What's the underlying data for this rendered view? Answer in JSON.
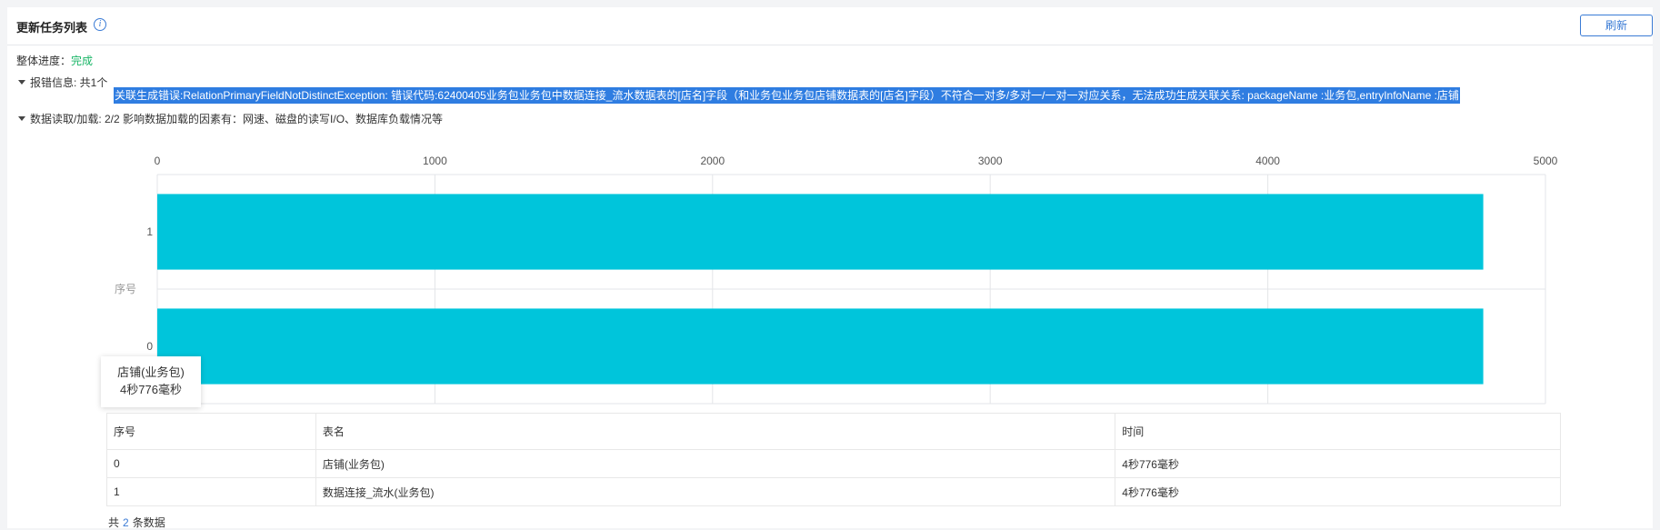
{
  "header": {
    "title": "更新任务列表",
    "refresh_label": "刷新"
  },
  "progress": {
    "label": "整体进度：",
    "status": "完成",
    "status_color": "#18b566"
  },
  "error_section": {
    "summary": "报错信息: 共1个",
    "message": "关联生成错误:RelationPrimaryFieldNotDistinctException: 错误代码:62400405业务包业务包中数据连接_流水数据表的[店名]字段（和业务包业务包店铺数据表的[店名]字段）不符合一对多/多对一/一对一对应关系，无法成功生成关联关系: packageName :业务包,entryInfoName :店铺"
  },
  "load_section": {
    "summary": "数据读取/加载: 2/2 影响数据加载的因素有：网速、磁盘的读写I/O、数据库负载情况等"
  },
  "chart_data": {
    "type": "bar",
    "orientation": "horizontal",
    "categories": [
      "1",
      "0"
    ],
    "values": [
      4776,
      4776
    ],
    "ylabel": "序号",
    "xlim": [
      0,
      5000
    ],
    "xticks": [
      "0",
      "1000",
      "2000",
      "3000",
      "4000",
      "5000"
    ],
    "color": "#00c5db",
    "grid": true
  },
  "tooltip": {
    "name": "店铺(业务包)",
    "value": "4秒776毫秒"
  },
  "table": {
    "headers": [
      "序号",
      "表名",
      "时间"
    ],
    "rows": [
      [
        "0",
        "店铺(业务包)",
        "4秒776毫秒"
      ],
      [
        "1",
        "数据连接_流水(业务包)",
        "4秒776毫秒"
      ]
    ]
  },
  "footer": {
    "prefix": "共",
    "count": "2",
    "suffix": "条数据"
  }
}
